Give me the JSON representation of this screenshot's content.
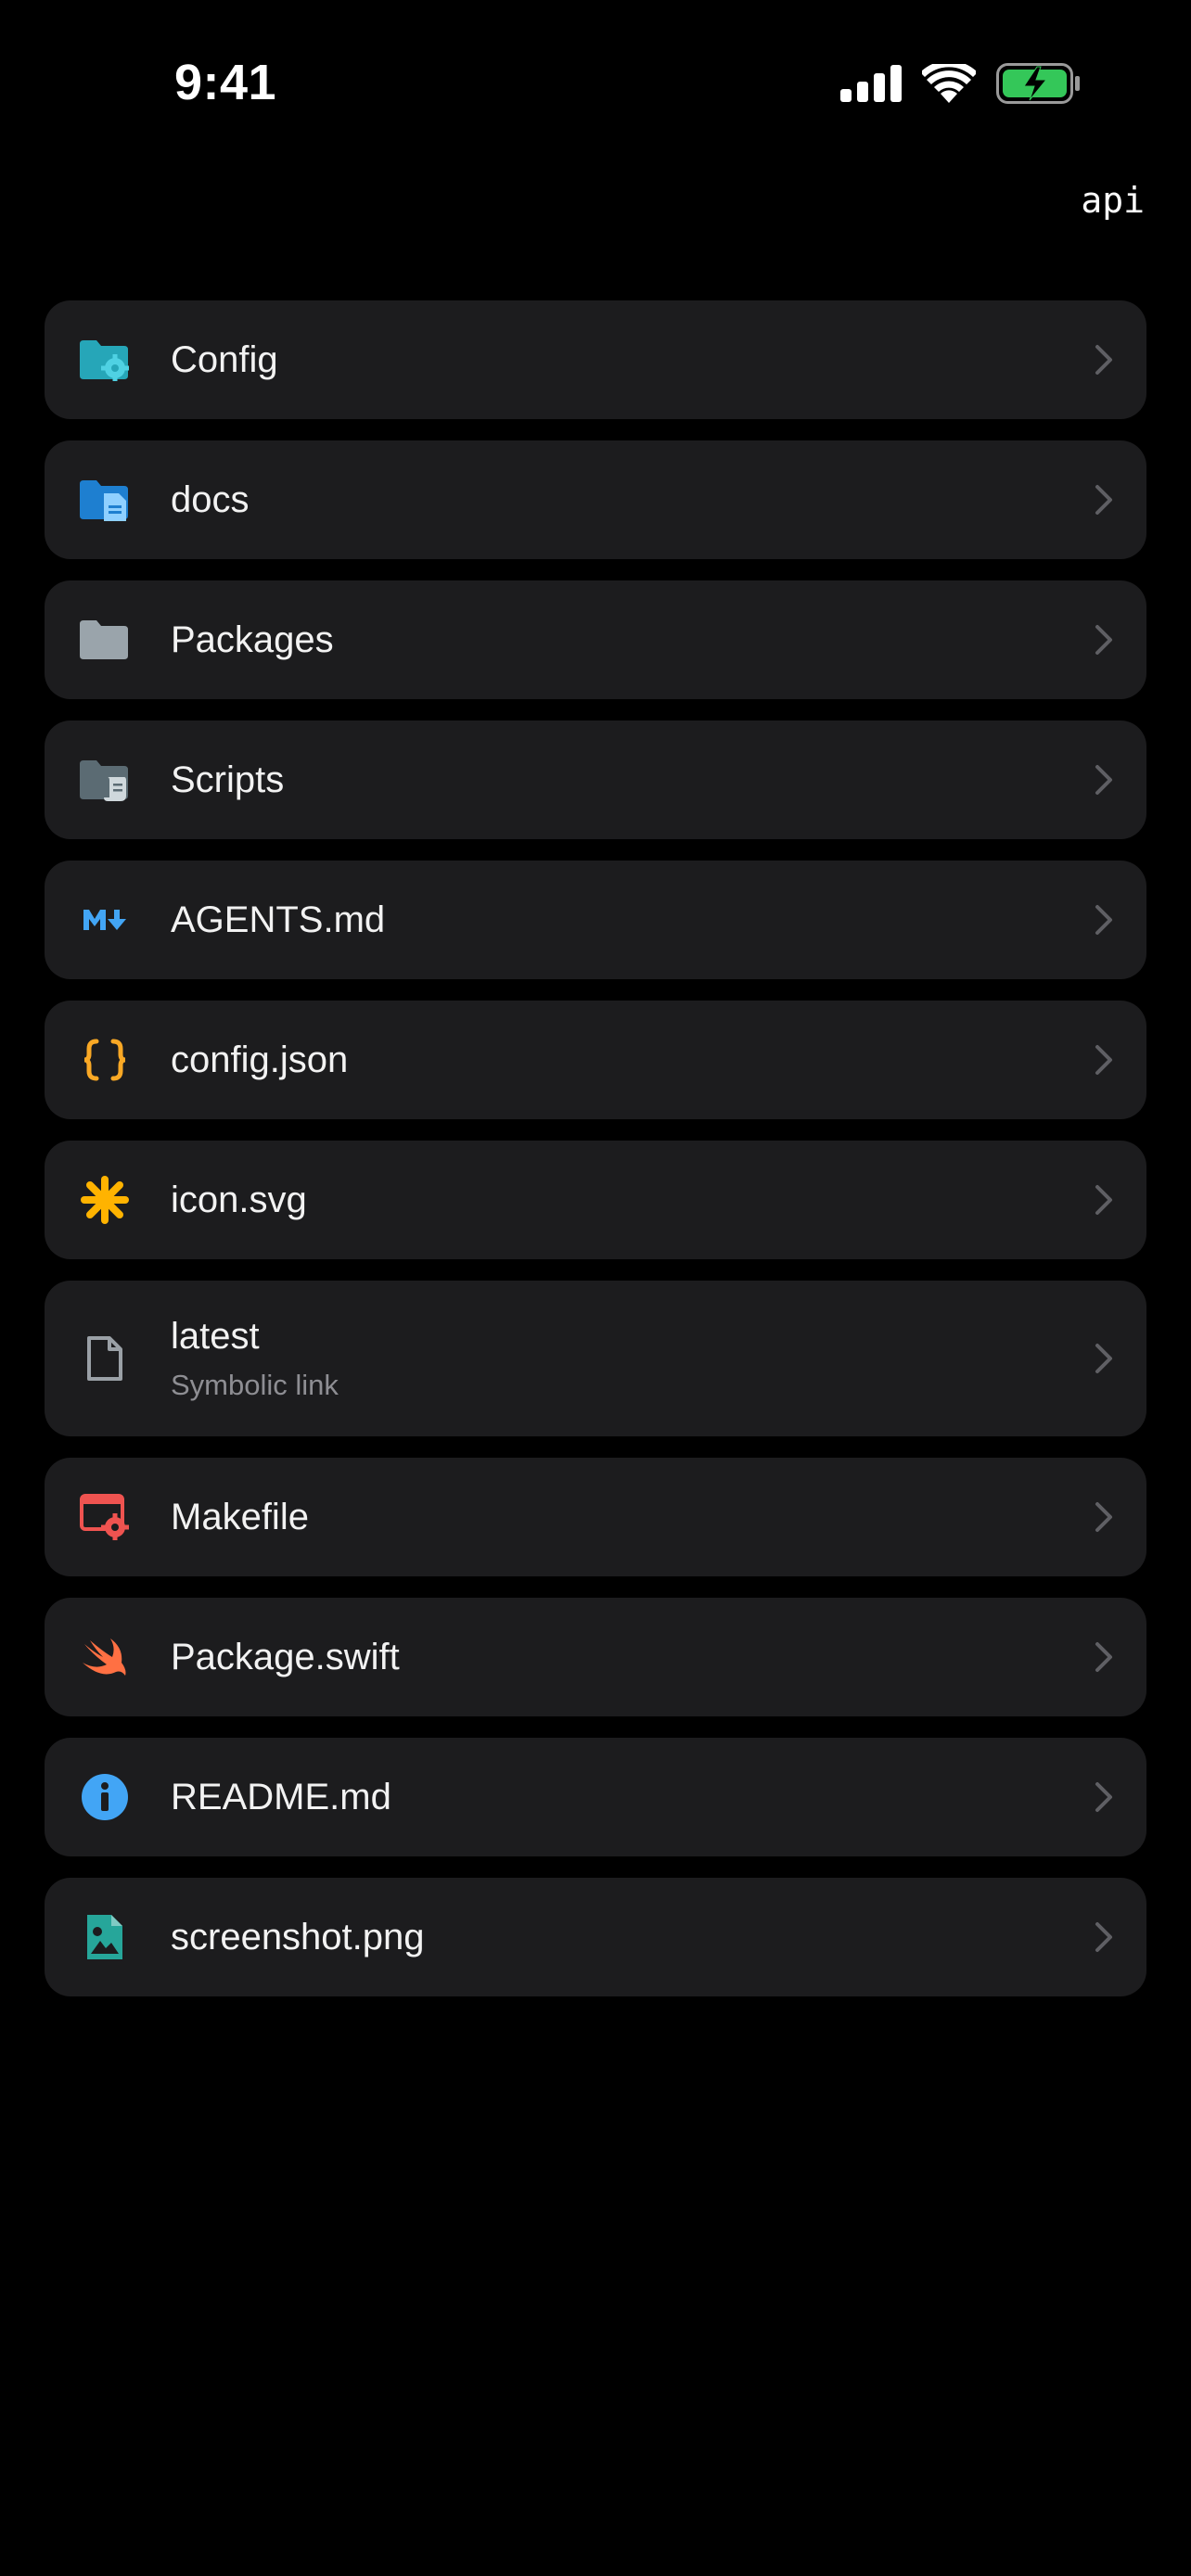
{
  "status_bar": {
    "time": "9:41"
  },
  "header": {
    "path": "api"
  },
  "files": [
    {
      "name": "Config",
      "icon": "folder-config-icon"
    },
    {
      "name": "docs",
      "icon": "folder-docs-icon"
    },
    {
      "name": "Packages",
      "icon": "folder-icon"
    },
    {
      "name": "Scripts",
      "icon": "folder-scripts-icon"
    },
    {
      "name": "AGENTS.md",
      "icon": "markdown-icon"
    },
    {
      "name": "config.json",
      "icon": "json-icon"
    },
    {
      "name": "icon.svg",
      "icon": "svg-icon"
    },
    {
      "name": "latest",
      "subtitle": "Symbolic link",
      "icon": "file-icon"
    },
    {
      "name": "Makefile",
      "icon": "makefile-icon"
    },
    {
      "name": "Package.swift",
      "icon": "swift-icon"
    },
    {
      "name": "README.md",
      "icon": "info-icon"
    },
    {
      "name": "screenshot.png",
      "icon": "image-icon"
    }
  ]
}
